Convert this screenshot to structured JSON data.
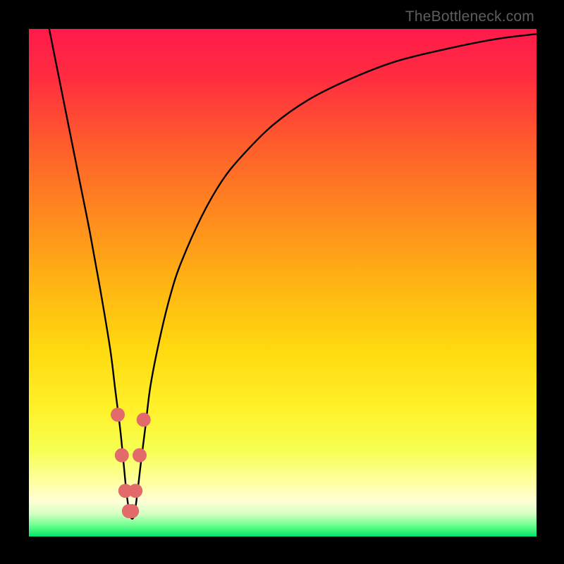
{
  "watermark": "TheBottleneck.com",
  "chart_data": {
    "type": "line",
    "title": "",
    "xlabel": "",
    "ylabel": "",
    "xlim": [
      0,
      100
    ],
    "ylim": [
      0,
      100
    ],
    "x": [
      4,
      6,
      8,
      10,
      12,
      14,
      16,
      17,
      18,
      18.7,
      19.3,
      20,
      20.7,
      21.3,
      22,
      23,
      24,
      26,
      28,
      30,
      34,
      38,
      42,
      48,
      55,
      63,
      72,
      82,
      92,
      100
    ],
    "values": [
      100,
      90,
      80,
      70,
      60,
      49,
      37,
      29,
      21,
      14,
      8,
      4,
      4,
      8,
      14,
      22,
      30,
      40,
      48,
      54,
      63,
      70,
      75,
      81,
      86,
      90,
      93.5,
      96,
      98,
      99
    ],
    "marker_region_x": [
      17.5,
      18.3,
      19.0,
      19.7,
      20.3,
      21.0,
      21.8,
      22.6
    ],
    "marker_region_y": [
      24,
      16,
      9,
      5,
      5,
      9,
      16,
      23
    ],
    "gradient_stops": [
      {
        "offset": 0.0,
        "color": "#ff1a4b"
      },
      {
        "offset": 0.1,
        "color": "#ff2e3f"
      },
      {
        "offset": 0.22,
        "color": "#ff5a2d"
      },
      {
        "offset": 0.35,
        "color": "#ff8420"
      },
      {
        "offset": 0.5,
        "color": "#ffb313"
      },
      {
        "offset": 0.63,
        "color": "#ffd90f"
      },
      {
        "offset": 0.75,
        "color": "#fff12a"
      },
      {
        "offset": 0.83,
        "color": "#f5ff52"
      },
      {
        "offset": 0.89,
        "color": "#ffff9d"
      },
      {
        "offset": 0.93,
        "color": "#ffffd5"
      },
      {
        "offset": 0.955,
        "color": "#d6ffc4"
      },
      {
        "offset": 0.98,
        "color": "#62ff89"
      },
      {
        "offset": 1.0,
        "color": "#00e46a"
      }
    ],
    "curve_color": "#000000",
    "marker_color": "#e26a6a"
  }
}
